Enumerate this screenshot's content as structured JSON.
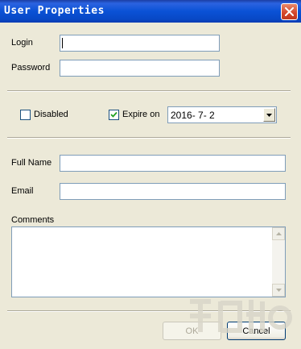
{
  "window": {
    "title": "User Properties"
  },
  "fields": {
    "login_label": "Login",
    "login_value": "",
    "password_label": "Password",
    "password_value": "",
    "disabled_label": "Disabled",
    "disabled_checked": false,
    "expire_label": "Expire on",
    "expire_checked": true,
    "expire_date": "2016- 7- 2",
    "fullname_label": "Full Name",
    "fullname_value": "",
    "email_label": "Email",
    "email_value": "",
    "comments_label": "Comments",
    "comments_value": ""
  },
  "buttons": {
    "ok_label": "OK",
    "ok_enabled": false,
    "cancel_label": "Cancel"
  },
  "colors": {
    "titlebar": "#0A52D6",
    "dialog_bg": "#ECE9D8",
    "close_button": "#D4452A"
  },
  "icons": [
    "close-icon",
    "check-icon",
    "dropdown-arrow-icon",
    "scroll-up-icon",
    "scroll-down-icon"
  ]
}
